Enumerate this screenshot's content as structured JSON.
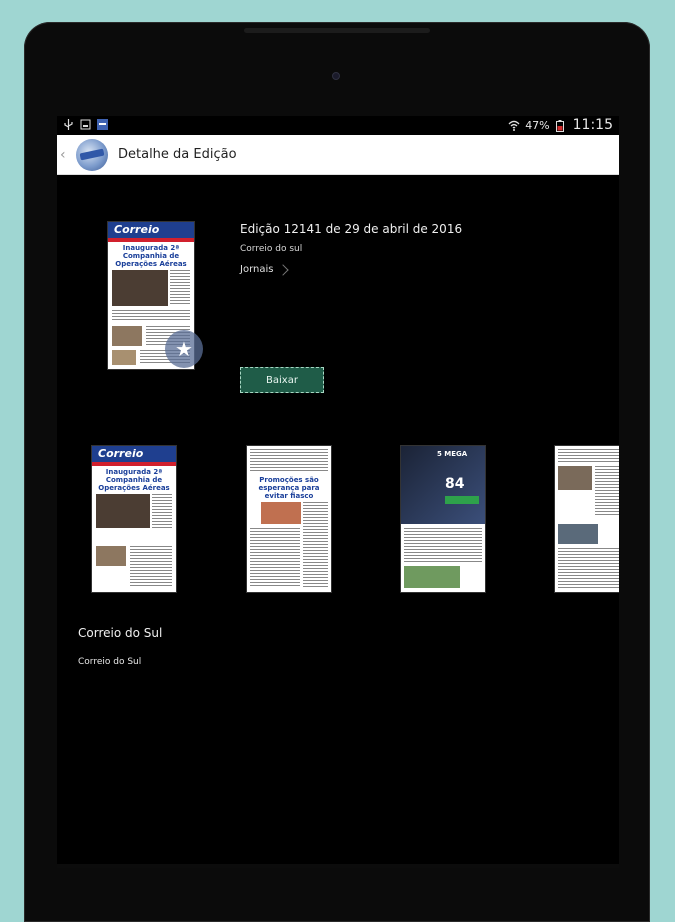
{
  "status_bar": {
    "battery": "47%",
    "time": "11:15"
  },
  "app_bar": {
    "title": "Detalhe da Edição"
  },
  "edition": {
    "title": "Edição 12141 de 29 de abril de 2016",
    "publisher": "Correio do sul",
    "category": "Jornais",
    "download_label": "Baixar",
    "cover_masthead": "Correio",
    "cover_headline": "Inaugurada 2ª Companhia de Operações Aéreas"
  },
  "pages": [
    {
      "masthead": "Correio",
      "headline": "Inaugurada 2ª Companhia de Operações Aéreas"
    },
    {
      "masthead": "",
      "headline": "Promoções são esperança para evitar fiasco"
    },
    {
      "masthead": "5 MEGA",
      "headline": "84"
    },
    {
      "masthead": "",
      "headline": ""
    }
  ],
  "section": {
    "title": "Correio do Sul",
    "subtitle": "Correio do Sul"
  },
  "colors": {
    "background": "#9fd6d2",
    "accent_button": "#1f5c48",
    "masthead_blue": "#1f3f8f",
    "masthead_red": "#d1202d"
  },
  "icons": {
    "back": "chevron-left-icon",
    "favorite": "star-icon",
    "wifi": "wifi-icon",
    "battery": "battery-icon"
  }
}
